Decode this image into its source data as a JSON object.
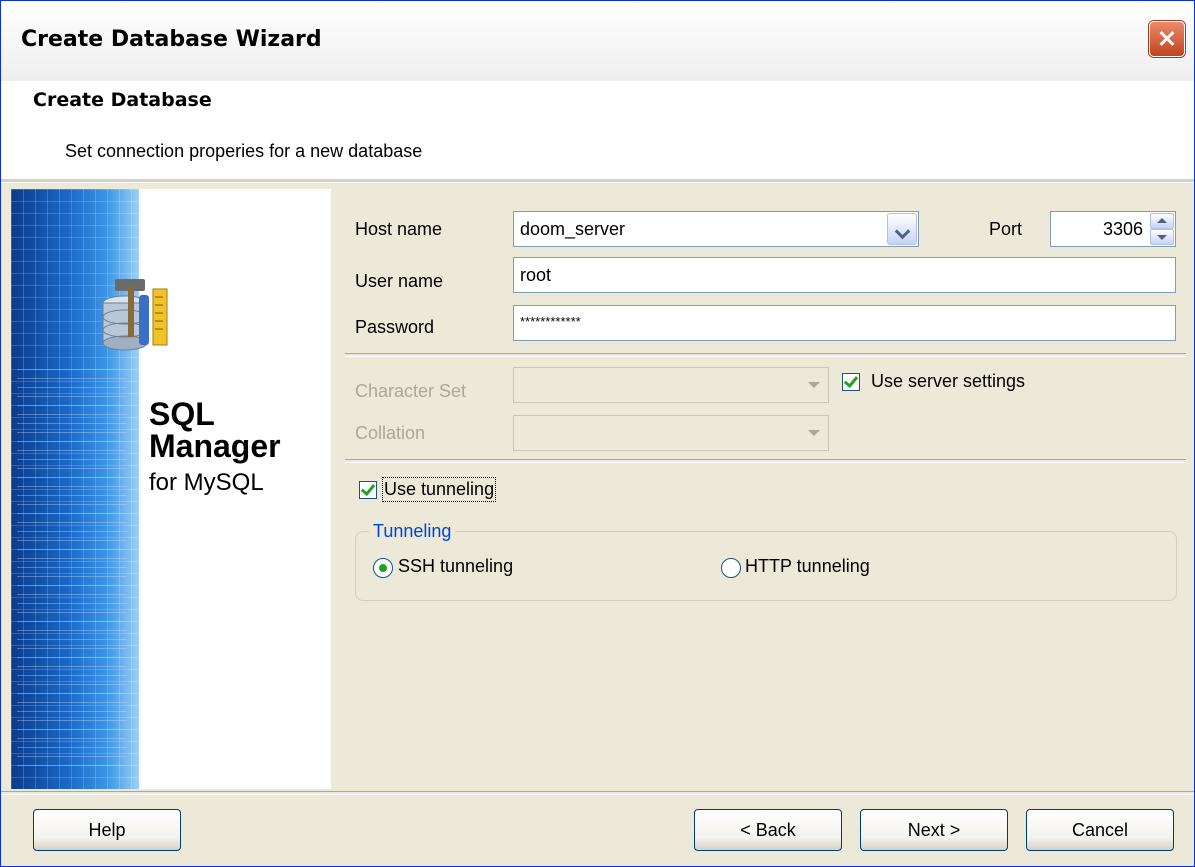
{
  "window": {
    "title": "Create Database Wizard"
  },
  "header": {
    "title": "Create Database",
    "subtitle": "Set connection properies for a new database"
  },
  "brand": {
    "line1": "SQL",
    "line2": "Manager",
    "line3": "for MySQL"
  },
  "connection": {
    "host_label": "Host name",
    "host_value": "doom_server",
    "port_label": "Port",
    "port_value": "3306",
    "user_label": "User name",
    "user_value": "root",
    "password_label": "Password",
    "password_value": "************"
  },
  "charset": {
    "charset_label": "Character Set",
    "charset_value": "",
    "collation_label": "Collation",
    "collation_value": "",
    "use_server_settings_label": "Use server settings",
    "use_server_settings_checked": true
  },
  "tunneling": {
    "use_tunneling_label": "Use tunneling",
    "use_tunneling_checked": true,
    "group_label": "Tunneling",
    "ssh_label": "SSH tunneling",
    "ssh_selected": true,
    "http_label": "HTTP tunneling",
    "http_selected": false
  },
  "buttons": {
    "help": "Help",
    "back": "< Back",
    "next": "Next >",
    "cancel": "Cancel"
  },
  "colors": {
    "title_border": "#0831d9",
    "close": "#c1431d",
    "check": "#21a121",
    "group_legend": "#0046d5"
  }
}
